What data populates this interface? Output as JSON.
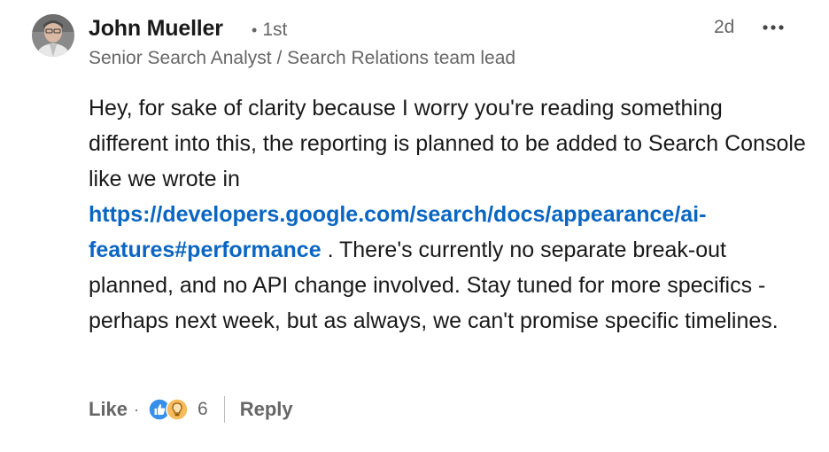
{
  "author": {
    "name": "John Mueller",
    "degree_sep": "•",
    "degree": "1st",
    "headline": "Senior Search Analyst / Search Relations team lead",
    "avatar_icon": "profile-photo"
  },
  "meta": {
    "timestamp": "2d",
    "more_icon": "ellipsis-icon"
  },
  "comment": {
    "text_before_link": "Hey, for sake of clarity because I worry you're reading something different into this, the reporting is planned to be added to Search Console like we wrote in ",
    "link_text": "https://developers.google.com/search/docs/appearance/ai-features#performance",
    "text_after_link": " . There's currently no separate break-out planned, and no API change involved. Stay tuned for more specifics - perhaps next week, but as always, we can't promise specific timelines."
  },
  "actions": {
    "like_label": "Like",
    "sep": "·",
    "reaction_icons": [
      "thumbs-up-icon",
      "lightbulb-icon"
    ],
    "reaction_count": "6",
    "reply_label": "Reply"
  },
  "colors": {
    "link": "#0a66c2",
    "like_reaction": "#378fe9",
    "insightful_reaction": "#f5bb5c",
    "muted_text": "#666666"
  }
}
